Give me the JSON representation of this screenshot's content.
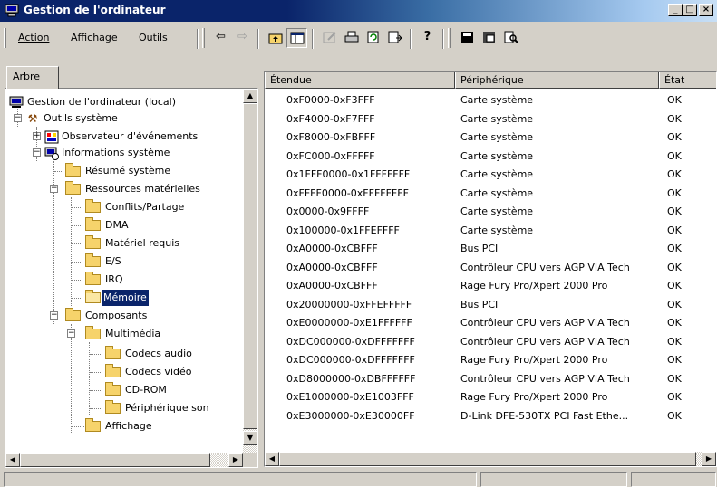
{
  "window": {
    "title": "Gestion de l'ordinateur",
    "min_glyph": "_",
    "max_glyph": "□",
    "close_glyph": "×"
  },
  "menu": {
    "action": "Action",
    "affichage": "Affichage",
    "outils": "Outils"
  },
  "toolbar": {
    "back": "⇦",
    "forward": "⇨",
    "up_icon": "up-folder-icon",
    "tree_toggle_icon": "show-hide-tree-icon",
    "properties_icon": "properties-icon",
    "print_icon": "print-icon",
    "refresh_icon": "refresh-icon",
    "export_icon": "export-list-icon",
    "help_glyph": "?",
    "save_icon": "save-icon",
    "save_info_icon": "save-system-info-icon",
    "find_icon": "find-icon"
  },
  "left_pane": {
    "tab_label": "Arbre",
    "tree": [
      {
        "label": "Gestion de l'ordinateur (local)",
        "level": 0,
        "icon": "computer-icon"
      },
      {
        "label": "Outils système",
        "level": 1,
        "icon": "tools-icon",
        "expander": "−"
      },
      {
        "label": "Observateur d'événements",
        "level": 2,
        "icon": "event-viewer-icon",
        "expander": "+"
      },
      {
        "label": "Informations système",
        "level": 2,
        "icon": "system-info-icon",
        "expander": "−"
      },
      {
        "label": "Résumé système",
        "level": 3,
        "icon": "folder-icon"
      },
      {
        "label": "Ressources matérielles",
        "level": 3,
        "icon": "folder-icon",
        "expander": "−"
      },
      {
        "label": "Conflits/Partage",
        "level": 4,
        "icon": "folder-icon"
      },
      {
        "label": "DMA",
        "level": 4,
        "icon": "folder-icon"
      },
      {
        "label": "Matériel requis",
        "level": 4,
        "icon": "folder-icon"
      },
      {
        "label": "E/S",
        "level": 4,
        "icon": "folder-icon"
      },
      {
        "label": "IRQ",
        "level": 4,
        "icon": "folder-icon"
      },
      {
        "label": "Mémoire",
        "level": 4,
        "icon": "open-folder-icon",
        "selected": true
      },
      {
        "label": "Composants",
        "level": 3,
        "icon": "folder-icon",
        "expander": "−"
      },
      {
        "label": "Multimédia",
        "level": 4,
        "icon": "folder-icon",
        "expander": "−"
      },
      {
        "label": "Codecs audio",
        "level": 5,
        "icon": "folder-icon"
      },
      {
        "label": "Codecs vidéo",
        "level": 5,
        "icon": "folder-icon"
      },
      {
        "label": "CD-ROM",
        "level": 5,
        "icon": "folder-icon"
      },
      {
        "label": "Périphérique son",
        "level": 5,
        "icon": "folder-icon"
      },
      {
        "label": "Affichage",
        "level": 4,
        "icon": "folder-icon"
      },
      {
        "label": "...",
        "level": 4,
        "icon": "folder-icon"
      }
    ]
  },
  "list": {
    "columns": [
      "Étendue",
      "Périphérique",
      "État"
    ],
    "rows": [
      [
        "0xF0000-0xF3FFF",
        "Carte système",
        "OK"
      ],
      [
        "0xF4000-0xF7FFF",
        "Carte système",
        "OK"
      ],
      [
        "0xF8000-0xFBFFF",
        "Carte système",
        "OK"
      ],
      [
        "0xFC000-0xFFFFF",
        "Carte système",
        "OK"
      ],
      [
        "0x1FFF0000-0x1FFFFFFF",
        "Carte système",
        "OK"
      ],
      [
        "0xFFFF0000-0xFFFFFFFF",
        "Carte système",
        "OK"
      ],
      [
        "0x0000-0x9FFFF",
        "Carte système",
        "OK"
      ],
      [
        "0x100000-0x1FFEFFFF",
        "Carte système",
        "OK"
      ],
      [
        "0xA0000-0xCBFFF",
        "Bus PCI",
        "OK"
      ],
      [
        "0xA0000-0xCBFFF",
        "Contrôleur CPU vers AGP VIA Tech",
        "OK"
      ],
      [
        "0xA0000-0xCBFFF",
        "Rage Fury Pro/Xpert 2000 Pro",
        "OK"
      ],
      [
        "0x20000000-0xFFEFFFFF",
        "Bus PCI",
        "OK"
      ],
      [
        "0xE0000000-0xE1FFFFFF",
        "Contrôleur CPU vers AGP VIA Tech",
        "OK"
      ],
      [
        "0xDC000000-0xDFFFFFFF",
        "Contrôleur CPU vers AGP VIA Tech",
        "OK"
      ],
      [
        "0xDC000000-0xDFFFFFFF",
        "Rage Fury Pro/Xpert 2000 Pro",
        "OK"
      ],
      [
        "0xD8000000-0xDBFFFFFF",
        "Contrôleur CPU vers AGP VIA Tech",
        "OK"
      ],
      [
        "0xE1000000-0xE1003FFF",
        "Rage Fury Pro/Xpert 2000 Pro",
        "OK"
      ],
      [
        "0xE3000000-0xE30000FF",
        "D-Link DFE-530TX PCI Fast Ethe...",
        "OK"
      ]
    ]
  },
  "colors": {
    "title_active": "#0a246a",
    "selection": "#0a246a",
    "face": "#d4d0c8"
  }
}
